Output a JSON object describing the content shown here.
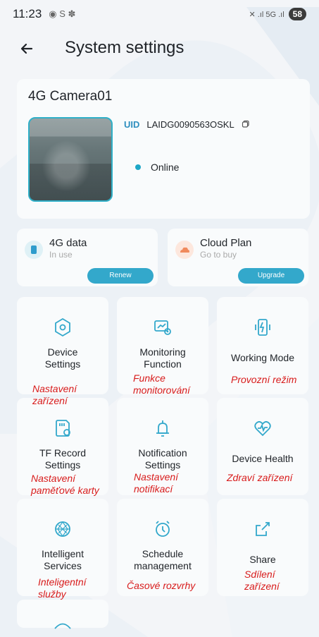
{
  "status": {
    "time": "11:23",
    "extra": "◉ S ✽",
    "signals": "✕ .ıl 5G .ıl",
    "battery": "58"
  },
  "header": {
    "title": "System settings"
  },
  "device": {
    "name": "4G Camera01",
    "uid_label": "UID",
    "uid_value": "LAIDG0090563OSKL",
    "status_text": "Online"
  },
  "data_card": {
    "title": "4G data",
    "sub": "In use",
    "button": "Renew"
  },
  "cloud_card": {
    "title": "Cloud Plan",
    "sub": "Go to buy",
    "button": "Upgrade"
  },
  "grid": [
    {
      "label": "Device\nSettings",
      "anno": "Nastavení\nzařízení",
      "icon": "hexagon-icon"
    },
    {
      "label": "Monitoring\nFunction",
      "anno": "Funkce\nmonitorování",
      "icon": "monitoring-icon"
    },
    {
      "label": "Working Mode",
      "anno": "Provozní režim",
      "icon": "working-mode-icon"
    },
    {
      "label": "TF Record\nSettings",
      "anno": "Nastavení\npaměťové karty",
      "icon": "sd-card-icon"
    },
    {
      "label": "Notification\nSettings",
      "anno": "Nastavení\nnotifikací",
      "icon": "bell-icon"
    },
    {
      "label": "Device Health",
      "anno": "Zdraví zařízení",
      "icon": "heart-icon"
    },
    {
      "label": "Intelligent\nServices",
      "anno": "Inteligentní\nslužby",
      "icon": "globe-icon"
    },
    {
      "label": "Schedule\nmanagement",
      "anno": "Časové rozvrhy",
      "icon": "alarm-clock-icon"
    },
    {
      "label": "Share",
      "anno": "Sdílení\nzařízení",
      "icon": "share-icon"
    }
  ],
  "colors": {
    "accent": "#33a8cb",
    "annotation": "#d81b1b"
  }
}
